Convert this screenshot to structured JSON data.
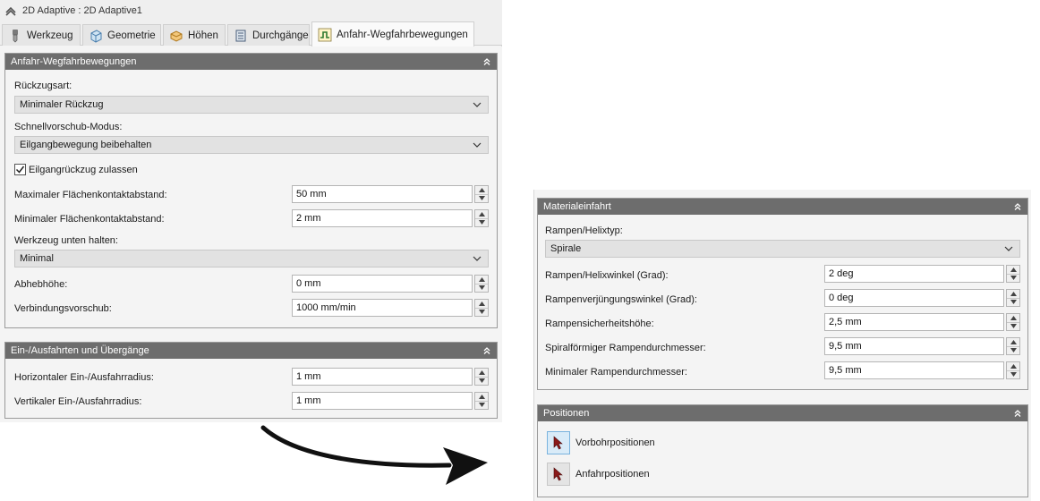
{
  "window": {
    "title": "2D Adaptive : 2D Adaptive1"
  },
  "tabs": [
    {
      "label": "Werkzeug",
      "icon": "tool-icon"
    },
    {
      "label": "Geometrie",
      "icon": "geometry-icon"
    },
    {
      "label": "Höhen",
      "icon": "heights-icon"
    },
    {
      "label": "Durchgänge",
      "icon": "passes-icon"
    },
    {
      "label": "Anfahr-Wegfahrbewegungen",
      "icon": "linking-icon",
      "active": true
    }
  ],
  "linking": {
    "title": "Anfahr-Wegfahrbewegungen",
    "retract_label": "Rückzugsart:",
    "retract_value": "Minimaler Rückzug",
    "rapid_label": "Schnellvorschub-Modus:",
    "rapid_value": "Eilgangbewegung beibehalten",
    "allow_rapid_label": "Eilgangrückzug zulassen",
    "allow_rapid_checked": true,
    "max_contact_label": "Maximaler Flächenkontaktabstand:",
    "max_contact_value": "50 mm",
    "min_contact_label": "Minimaler Flächenkontaktabstand:",
    "min_contact_value": "2 mm",
    "keep_down_label": "Werkzeug unten halten:",
    "keep_down_value": "Minimal",
    "lift_label": "Abhebhöhe:",
    "lift_value": "0 mm",
    "link_feed_label": "Verbindungsvorschub:",
    "link_feed_value": "1000 mm/min"
  },
  "leads": {
    "title": "Ein-/Ausfahrten und Übergänge",
    "horiz_label": "Horizontaler Ein-/Ausfahrradius:",
    "horiz_value": "1 mm",
    "vert_label": "Vertikaler Ein-/Ausfahrradius:",
    "vert_value": "1 mm"
  },
  "ramp": {
    "title": "Materialeinfahrt",
    "type_label": "Rampen/Helixtyp:",
    "type_value": "Spirale",
    "angle_label": "Rampen/Helixwinkel (Grad):",
    "angle_value": "2 deg",
    "taper_label": "Rampenverjüngungswinkel (Grad):",
    "taper_value": "0 deg",
    "clearance_label": "Rampensicherheitshöhe:",
    "clearance_value": "2,5 mm",
    "spiral_diam_label": "Spiralförmiger Rampendurchmesser:",
    "spiral_diam_value": "9,5 mm",
    "min_diam_label": "Minimaler Rampendurchmesser:",
    "min_diam_value": "9,5 mm"
  },
  "positions": {
    "title": "Positionen",
    "predrill_label": "Vorbohrpositionen",
    "entry_label": "Anfahrpositionen"
  },
  "colors": {
    "section_header": "#6d6d6d",
    "panel_bg": "#f4f4f4",
    "selected_button": "#d9ebf8",
    "pointer_icon": "#8b1a1a"
  }
}
